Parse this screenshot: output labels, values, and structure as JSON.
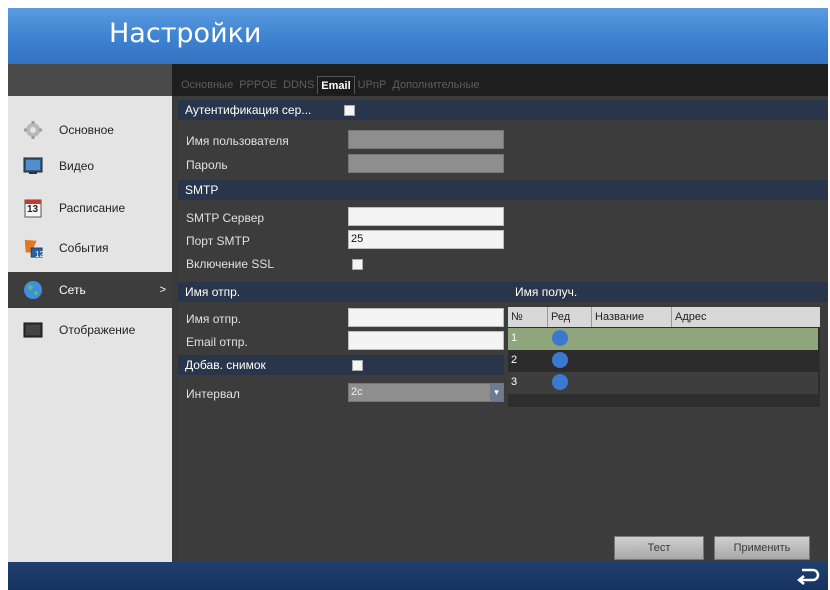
{
  "window": {
    "title": "Настройки"
  },
  "tabs": [
    "Основные",
    "PPPOE",
    "DDNS",
    "Email",
    "UPnP",
    "Дополнительные"
  ],
  "active_tab": "Email",
  "sidebar": {
    "items": [
      {
        "label": "Основное",
        "icon": "gear-icon"
      },
      {
        "label": "Видео",
        "icon": "monitor-icon"
      },
      {
        "label": "Расписание",
        "icon": "calendar-icon",
        "icon_text": "13"
      },
      {
        "label": "События",
        "icon": "flag-icon",
        "icon_text": "12"
      },
      {
        "label": "Сеть",
        "icon": "globe-icon",
        "arrow": ">"
      },
      {
        "label": "Отображение",
        "icon": "display-icon"
      }
    ],
    "active_index": 4
  },
  "auth": {
    "header": "Аутентификация сер...",
    "username_label": "Имя пользователя",
    "username_value": "",
    "password_label": "Пароль",
    "password_value": ""
  },
  "smtp": {
    "header": "SMTP",
    "server_label": "SMTP Сервер",
    "server_value": "",
    "port_label": "Порт SMTP",
    "port_value": "25",
    "ssl_label": "Включение SSL"
  },
  "sender": {
    "header": "Имя отпр.",
    "name_label": "Имя отпр.",
    "name_value": "",
    "email_label": "Email отпр.",
    "email_value": "",
    "snapshot_label": "Добав. снимок",
    "interval_label": "Интервал",
    "interval_value": "2с"
  },
  "recipients": {
    "header": "Имя получ.",
    "columns": [
      "№",
      "Ред",
      "Название",
      "Адрес"
    ],
    "rows": [
      {
        "num": "1",
        "edit_icon": "edit-icon"
      },
      {
        "num": "2",
        "edit_icon": "edit-icon"
      },
      {
        "num": "3",
        "edit_icon": "edit-icon"
      }
    ]
  },
  "buttons": {
    "test": "Тест",
    "apply": "Применить"
  },
  "colors": {
    "accent": "#3b7fce",
    "section_bar": "#28354a",
    "selected_row": "#8fa57c"
  }
}
